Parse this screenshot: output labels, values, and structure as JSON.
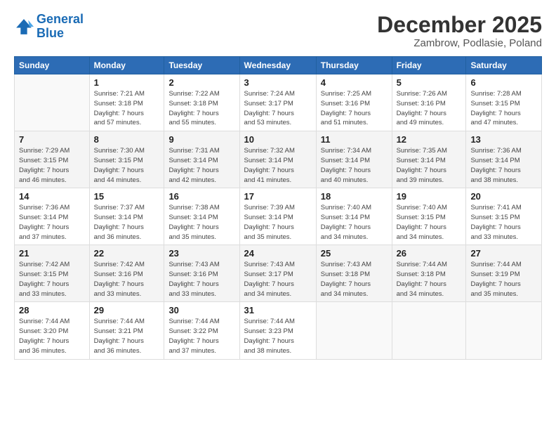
{
  "logo": {
    "line1": "General",
    "line2": "Blue"
  },
  "title": "December 2025",
  "subtitle": "Zambrow, Podlasie, Poland",
  "days_header": [
    "Sunday",
    "Monday",
    "Tuesday",
    "Wednesday",
    "Thursday",
    "Friday",
    "Saturday"
  ],
  "weeks": [
    [
      {
        "num": "",
        "info": ""
      },
      {
        "num": "1",
        "info": "Sunrise: 7:21 AM\nSunset: 3:18 PM\nDaylight: 7 hours\nand 57 minutes."
      },
      {
        "num": "2",
        "info": "Sunrise: 7:22 AM\nSunset: 3:18 PM\nDaylight: 7 hours\nand 55 minutes."
      },
      {
        "num": "3",
        "info": "Sunrise: 7:24 AM\nSunset: 3:17 PM\nDaylight: 7 hours\nand 53 minutes."
      },
      {
        "num": "4",
        "info": "Sunrise: 7:25 AM\nSunset: 3:16 PM\nDaylight: 7 hours\nand 51 minutes."
      },
      {
        "num": "5",
        "info": "Sunrise: 7:26 AM\nSunset: 3:16 PM\nDaylight: 7 hours\nand 49 minutes."
      },
      {
        "num": "6",
        "info": "Sunrise: 7:28 AM\nSunset: 3:15 PM\nDaylight: 7 hours\nand 47 minutes."
      }
    ],
    [
      {
        "num": "7",
        "info": "Sunrise: 7:29 AM\nSunset: 3:15 PM\nDaylight: 7 hours\nand 46 minutes."
      },
      {
        "num": "8",
        "info": "Sunrise: 7:30 AM\nSunset: 3:15 PM\nDaylight: 7 hours\nand 44 minutes."
      },
      {
        "num": "9",
        "info": "Sunrise: 7:31 AM\nSunset: 3:14 PM\nDaylight: 7 hours\nand 42 minutes."
      },
      {
        "num": "10",
        "info": "Sunrise: 7:32 AM\nSunset: 3:14 PM\nDaylight: 7 hours\nand 41 minutes."
      },
      {
        "num": "11",
        "info": "Sunrise: 7:34 AM\nSunset: 3:14 PM\nDaylight: 7 hours\nand 40 minutes."
      },
      {
        "num": "12",
        "info": "Sunrise: 7:35 AM\nSunset: 3:14 PM\nDaylight: 7 hours\nand 39 minutes."
      },
      {
        "num": "13",
        "info": "Sunrise: 7:36 AM\nSunset: 3:14 PM\nDaylight: 7 hours\nand 38 minutes."
      }
    ],
    [
      {
        "num": "14",
        "info": "Sunrise: 7:36 AM\nSunset: 3:14 PM\nDaylight: 7 hours\nand 37 minutes."
      },
      {
        "num": "15",
        "info": "Sunrise: 7:37 AM\nSunset: 3:14 PM\nDaylight: 7 hours\nand 36 minutes."
      },
      {
        "num": "16",
        "info": "Sunrise: 7:38 AM\nSunset: 3:14 PM\nDaylight: 7 hours\nand 35 minutes."
      },
      {
        "num": "17",
        "info": "Sunrise: 7:39 AM\nSunset: 3:14 PM\nDaylight: 7 hours\nand 35 minutes."
      },
      {
        "num": "18",
        "info": "Sunrise: 7:40 AM\nSunset: 3:14 PM\nDaylight: 7 hours\nand 34 minutes."
      },
      {
        "num": "19",
        "info": "Sunrise: 7:40 AM\nSunset: 3:15 PM\nDaylight: 7 hours\nand 34 minutes."
      },
      {
        "num": "20",
        "info": "Sunrise: 7:41 AM\nSunset: 3:15 PM\nDaylight: 7 hours\nand 33 minutes."
      }
    ],
    [
      {
        "num": "21",
        "info": "Sunrise: 7:42 AM\nSunset: 3:15 PM\nDaylight: 7 hours\nand 33 minutes."
      },
      {
        "num": "22",
        "info": "Sunrise: 7:42 AM\nSunset: 3:16 PM\nDaylight: 7 hours\nand 33 minutes."
      },
      {
        "num": "23",
        "info": "Sunrise: 7:43 AM\nSunset: 3:16 PM\nDaylight: 7 hours\nand 33 minutes."
      },
      {
        "num": "24",
        "info": "Sunrise: 7:43 AM\nSunset: 3:17 PM\nDaylight: 7 hours\nand 34 minutes."
      },
      {
        "num": "25",
        "info": "Sunrise: 7:43 AM\nSunset: 3:18 PM\nDaylight: 7 hours\nand 34 minutes."
      },
      {
        "num": "26",
        "info": "Sunrise: 7:44 AM\nSunset: 3:18 PM\nDaylight: 7 hours\nand 34 minutes."
      },
      {
        "num": "27",
        "info": "Sunrise: 7:44 AM\nSunset: 3:19 PM\nDaylight: 7 hours\nand 35 minutes."
      }
    ],
    [
      {
        "num": "28",
        "info": "Sunrise: 7:44 AM\nSunset: 3:20 PM\nDaylight: 7 hours\nand 36 minutes."
      },
      {
        "num": "29",
        "info": "Sunrise: 7:44 AM\nSunset: 3:21 PM\nDaylight: 7 hours\nand 36 minutes."
      },
      {
        "num": "30",
        "info": "Sunrise: 7:44 AM\nSunset: 3:22 PM\nDaylight: 7 hours\nand 37 minutes."
      },
      {
        "num": "31",
        "info": "Sunrise: 7:44 AM\nSunset: 3:23 PM\nDaylight: 7 hours\nand 38 minutes."
      },
      {
        "num": "",
        "info": ""
      },
      {
        "num": "",
        "info": ""
      },
      {
        "num": "",
        "info": ""
      }
    ]
  ]
}
